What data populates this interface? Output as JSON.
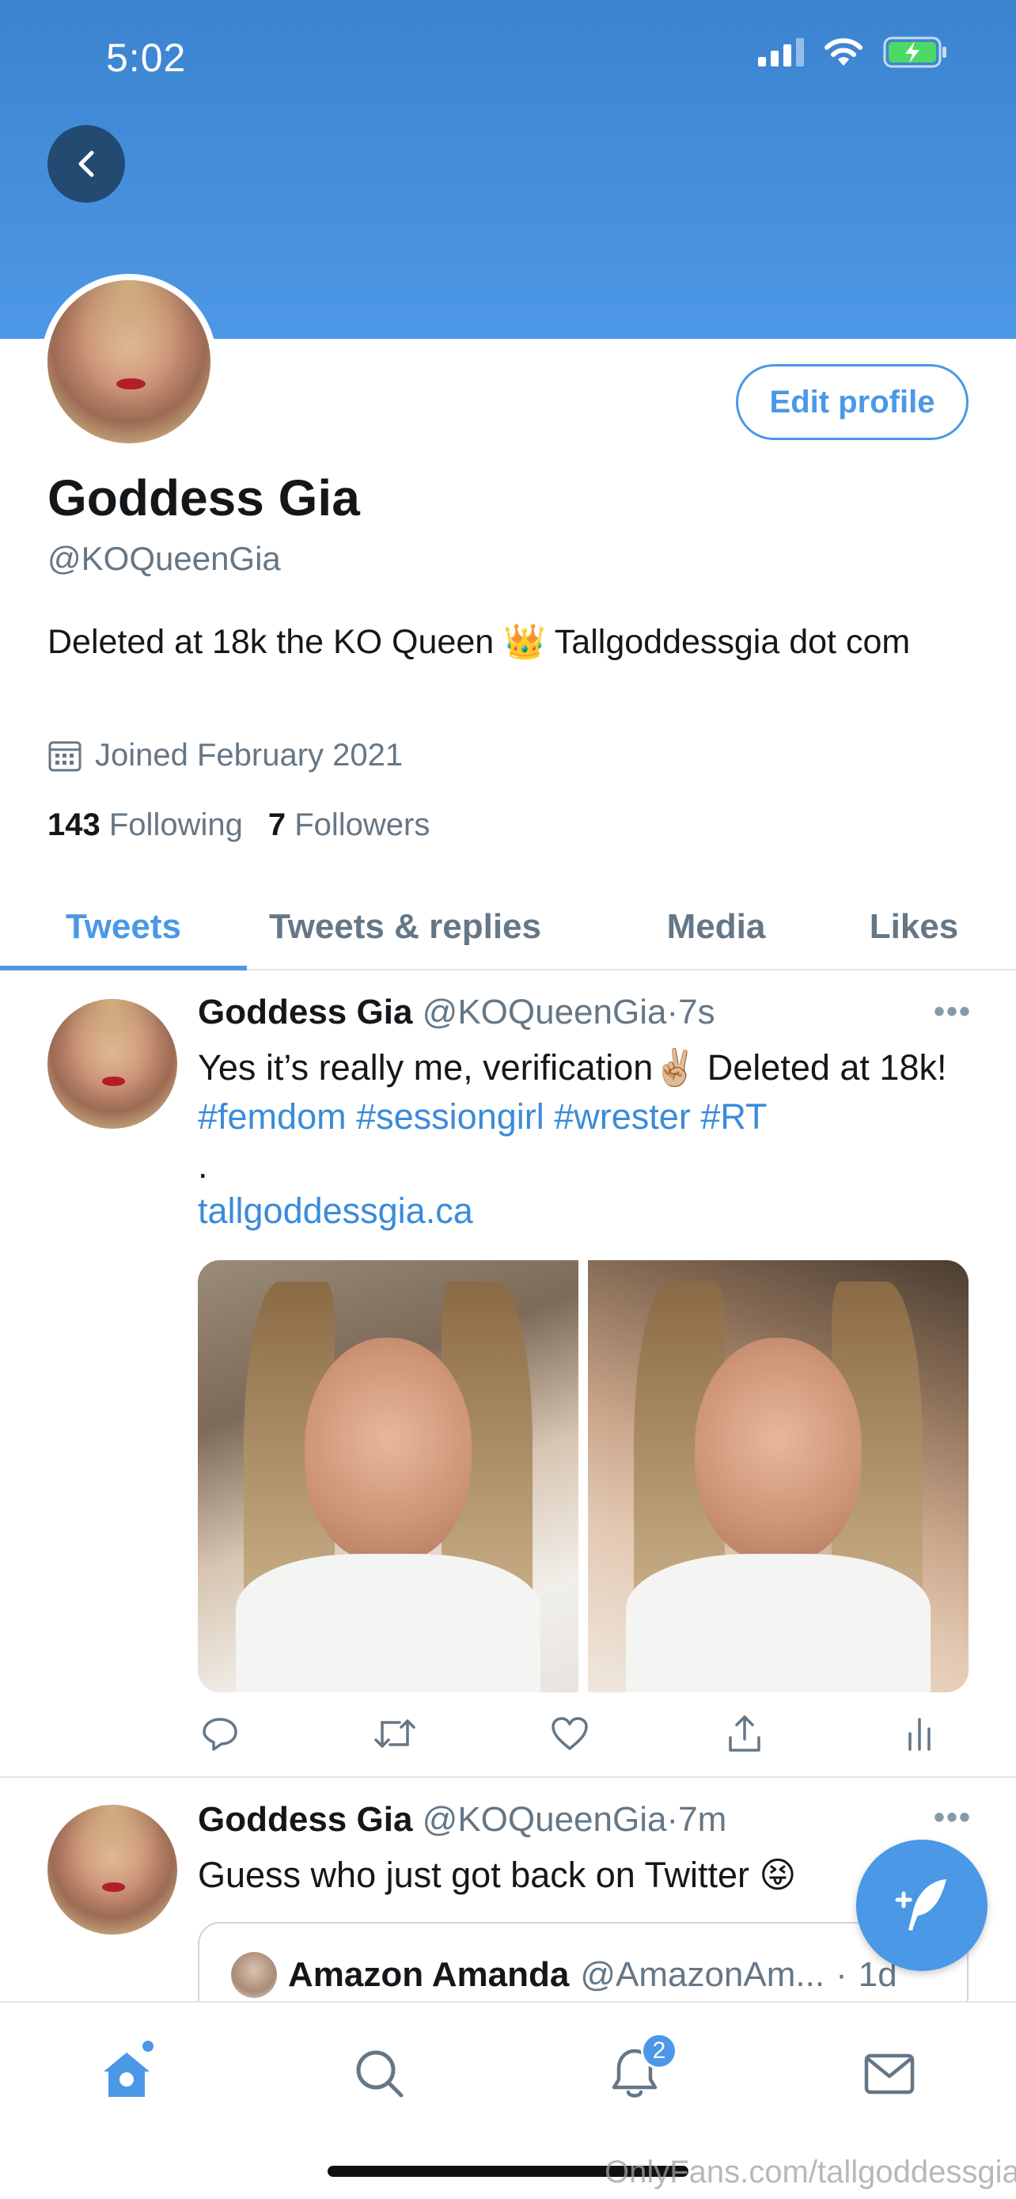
{
  "status_bar": {
    "time": "5:02"
  },
  "profile": {
    "name": "Goddess Gia",
    "handle": "@KOQueenGia",
    "bio": "Deleted at 18k the KO Queen 👑 Tallgoddessgia dot com",
    "joined": "Joined February 2021",
    "following_count": "143",
    "following_label": "Following",
    "followers_count": "7",
    "followers_label": "Followers",
    "edit_label": "Edit profile"
  },
  "tabs": [
    {
      "label": "Tweets",
      "active": true
    },
    {
      "label": "Tweets & replies",
      "active": false
    },
    {
      "label": "Media",
      "active": false
    },
    {
      "label": "Likes",
      "active": false
    }
  ],
  "tweets": [
    {
      "name": "Goddess Gia",
      "handle": "@KOQueenGia",
      "sep": "·",
      "time": "7s",
      "more": "•••",
      "text_plain": "Yes it’s really me, verification✌🏼 Deleted at 18k!",
      "hashtags": [
        "#femdom",
        "#sessiongirl",
        "#wrester",
        "#RT"
      ],
      "dot_line": ".",
      "link": "tallgoddessgia.ca"
    },
    {
      "name": "Goddess Gia",
      "handle": "@KOQueenGia",
      "sep": "·",
      "time": "7m",
      "more": "•••",
      "text": "Guess who just got back on Twitter 😝",
      "quoted": {
        "name": "Amazon Amanda",
        "handle": "@AmazonAm...",
        "sep": "·",
        "time": "1d"
      }
    }
  ],
  "tabbar": {
    "notifications_badge": "2"
  },
  "watermark": "OnlyFans.com/tallgoddessgia",
  "colors": {
    "accent": "#4a98e6",
    "header": "#3b83cf",
    "back_button": "#234a71",
    "muted": "#657786"
  }
}
